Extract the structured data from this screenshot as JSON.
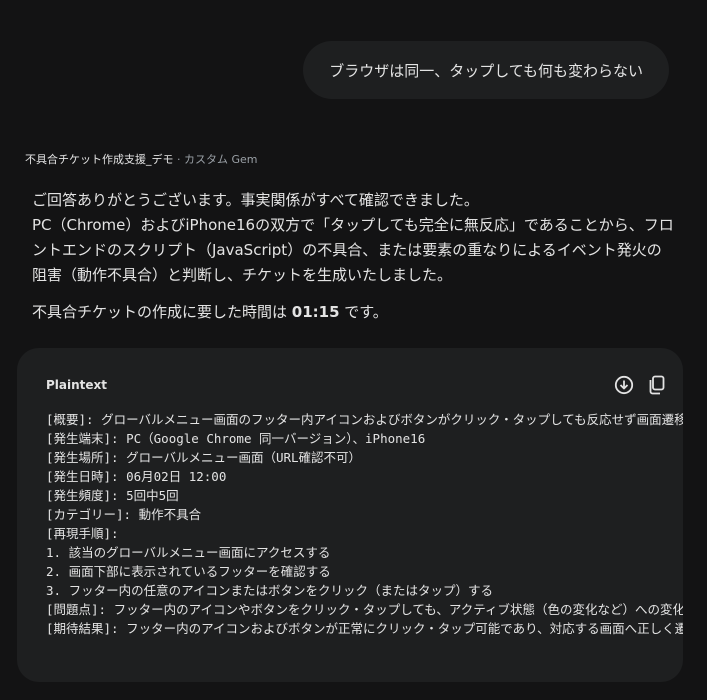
{
  "user_message": "ブラウザは同一、タップしても何も変わらない",
  "gem": {
    "name": "不具合チケット作成支援_デモ",
    "separator": " · ",
    "type": "カスタム Gem"
  },
  "response": {
    "lines": [
      "ご回答ありがとうございます。事実関係がすべて確認できました。",
      "PC（Chrome）およびiPhone16の双方で「タップしても完全に無反応」であることから、フロ",
      "ントエンドのスクリプト（JavaScript）の不具合、または要素の重なりによるイベント発火の",
      "阻害（動作不具合）と判断し、チケットを生成いたしました。"
    ],
    "time_prefix": "不具合チケットの作成に要した時間は ",
    "time_value": "01:15",
    "time_suffix": " です。"
  },
  "code_block": {
    "language": "Plaintext",
    "lines": [
      "[概要]: グローバルメニュー画面のフッター内アイコンおよびボタンがクリック・タップしても反応せず画面遷移しない",
      "[発生端末]: PC（Google Chrome 同一バージョン）、iPhone16",
      "[発生場所]: グローバルメニュー画面（URL確認不可）",
      "[発生日時]: 06月02日 12:00",
      "[発生頻度]: 5回中5回",
      "[カテゴリー]: 動作不具合",
      "[再現手順]:",
      "1. 該当のグローバルメニュー画面にアクセスする",
      "2. 画面下部に表示されているフッターを確認する",
      "3. フッター内の任意のアイコンまたはボタンをクリック（またはタップ）する",
      "[問題点]: フッター内のアイコンやボタンをクリック・タップしても、アクティブ状態（色の変化など）への変化がない",
      "[期待結果]: フッター内のアイコンおよびボタンが正常にクリック・タップ可能であり、対応する画面へ正しく遷移する"
    ]
  },
  "icons": {
    "download": "download-icon",
    "copy": "copy-icon"
  },
  "colors": {
    "background": "#131314",
    "bubble": "#1e1f20",
    "text": "#e3e3e3",
    "muted": "#9aa0a6"
  }
}
